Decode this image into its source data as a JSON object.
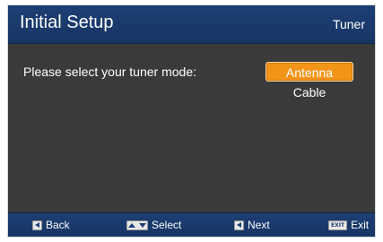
{
  "header": {
    "title": "Initial Setup",
    "section": "Tuner"
  },
  "body": {
    "prompt": "Please select your tuner mode:",
    "options": [
      {
        "label": "Antenna",
        "selected": true
      },
      {
        "label": "Cable",
        "selected": false
      }
    ]
  },
  "footer": {
    "back_label": "Back",
    "select_label": "Select",
    "next_label": "Next",
    "exit_key": "EXIT",
    "exit_label": "Exit"
  },
  "colors": {
    "header_bg": "#1d3f74",
    "body_bg": "#3a3a3a",
    "highlight": "#f29418"
  },
  "icons": {
    "back": "left-arrow-key-icon",
    "select": "up-down-arrow-keys-icon",
    "next": "left-arrow-key-icon",
    "exit": "exit-key-icon"
  }
}
